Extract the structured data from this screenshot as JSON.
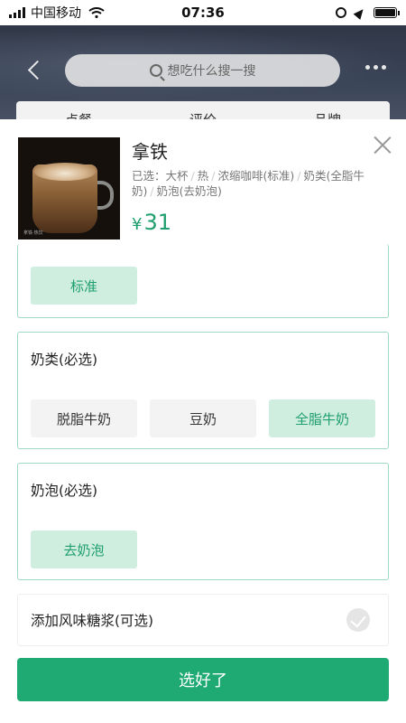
{
  "status_bar": {
    "carrier": "中国移动",
    "time": "07:36",
    "battery_percent": 100
  },
  "header": {
    "search_placeholder": "想吃什么搜一搜"
  },
  "background_tabs": [
    "点餐",
    "评价",
    "品牌"
  ],
  "product": {
    "name": "拿铁",
    "selected_prefix": "已选：",
    "selected_items": [
      "大杯",
      "热",
      "浓缩咖啡(标准)",
      "奶类(全脂牛奶)",
      "奶泡(去奶泡)"
    ],
    "currency": "¥",
    "price": "31",
    "image_caption": "拿铁·热饮"
  },
  "option_groups": [
    {
      "title": "",
      "options": [
        {
          "label": "标准",
          "selected": true
        }
      ]
    },
    {
      "title": "奶类(必选)",
      "options": [
        {
          "label": "脱脂牛奶",
          "selected": false
        },
        {
          "label": "豆奶",
          "selected": false
        },
        {
          "label": "全脂牛奶",
          "selected": true
        }
      ]
    },
    {
      "title": "奶泡(必选)",
      "options": [
        {
          "label": "去奶泡",
          "selected": true
        }
      ]
    }
  ],
  "syrup": {
    "label": "添加风味糖浆(可选)",
    "checked": false
  },
  "confirm_label": "选好了",
  "colors": {
    "accent": "#1eaa72",
    "accent_text": "#1f9e6e",
    "selected_bg": "#cfeee0",
    "border": "#9fd9c2"
  },
  "icons": [
    "signal-icon",
    "wifi-icon",
    "rotation-lock-icon",
    "location-icon",
    "battery-icon",
    "back-arrow-icon",
    "search-icon",
    "more-icon",
    "close-icon",
    "check-icon"
  ]
}
